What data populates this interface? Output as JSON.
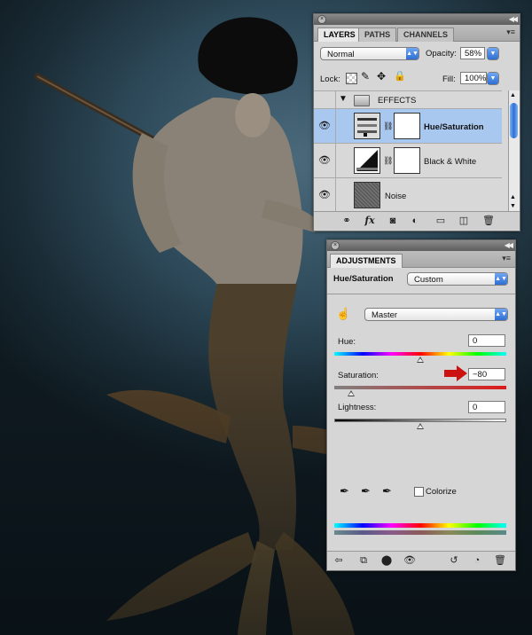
{
  "layers_panel": {
    "tabs": [
      "LAYERS",
      "PATHS",
      "CHANNELS"
    ],
    "blend_mode": "Normal",
    "opacity_label": "Opacity:",
    "opacity_value": "58%",
    "lock_label": "Lock:",
    "fill_label": "Fill:",
    "fill_value": "100%",
    "group_name": "EFFECTS",
    "layers": [
      {
        "name": "Hue/Saturation",
        "selected": true
      },
      {
        "name": "Black & White",
        "selected": false
      },
      {
        "name": "Noise",
        "selected": false
      }
    ],
    "selection_color": "#a9c8f0"
  },
  "adjustments_panel": {
    "tab": "ADJUSTMENTS",
    "adjustment_name": "Hue/Saturation",
    "preset_value": "Custom",
    "channel_value": "Master",
    "hue_label": "Hue:",
    "hue_value": "0",
    "saturation_label": "Saturation:",
    "saturation_value": "−80",
    "lightness_label": "Lightness:",
    "lightness_value": "0",
    "colorize_label": "Colorize",
    "colorize_checked": false,
    "sliders": {
      "hue": 0,
      "saturation": -80,
      "lightness": 0
    },
    "arrow_color": "#cc1111"
  },
  "icons": {
    "eye": "eye-icon",
    "folder": "folder-icon",
    "link": "link-icon",
    "lock": "lock-icon"
  }
}
